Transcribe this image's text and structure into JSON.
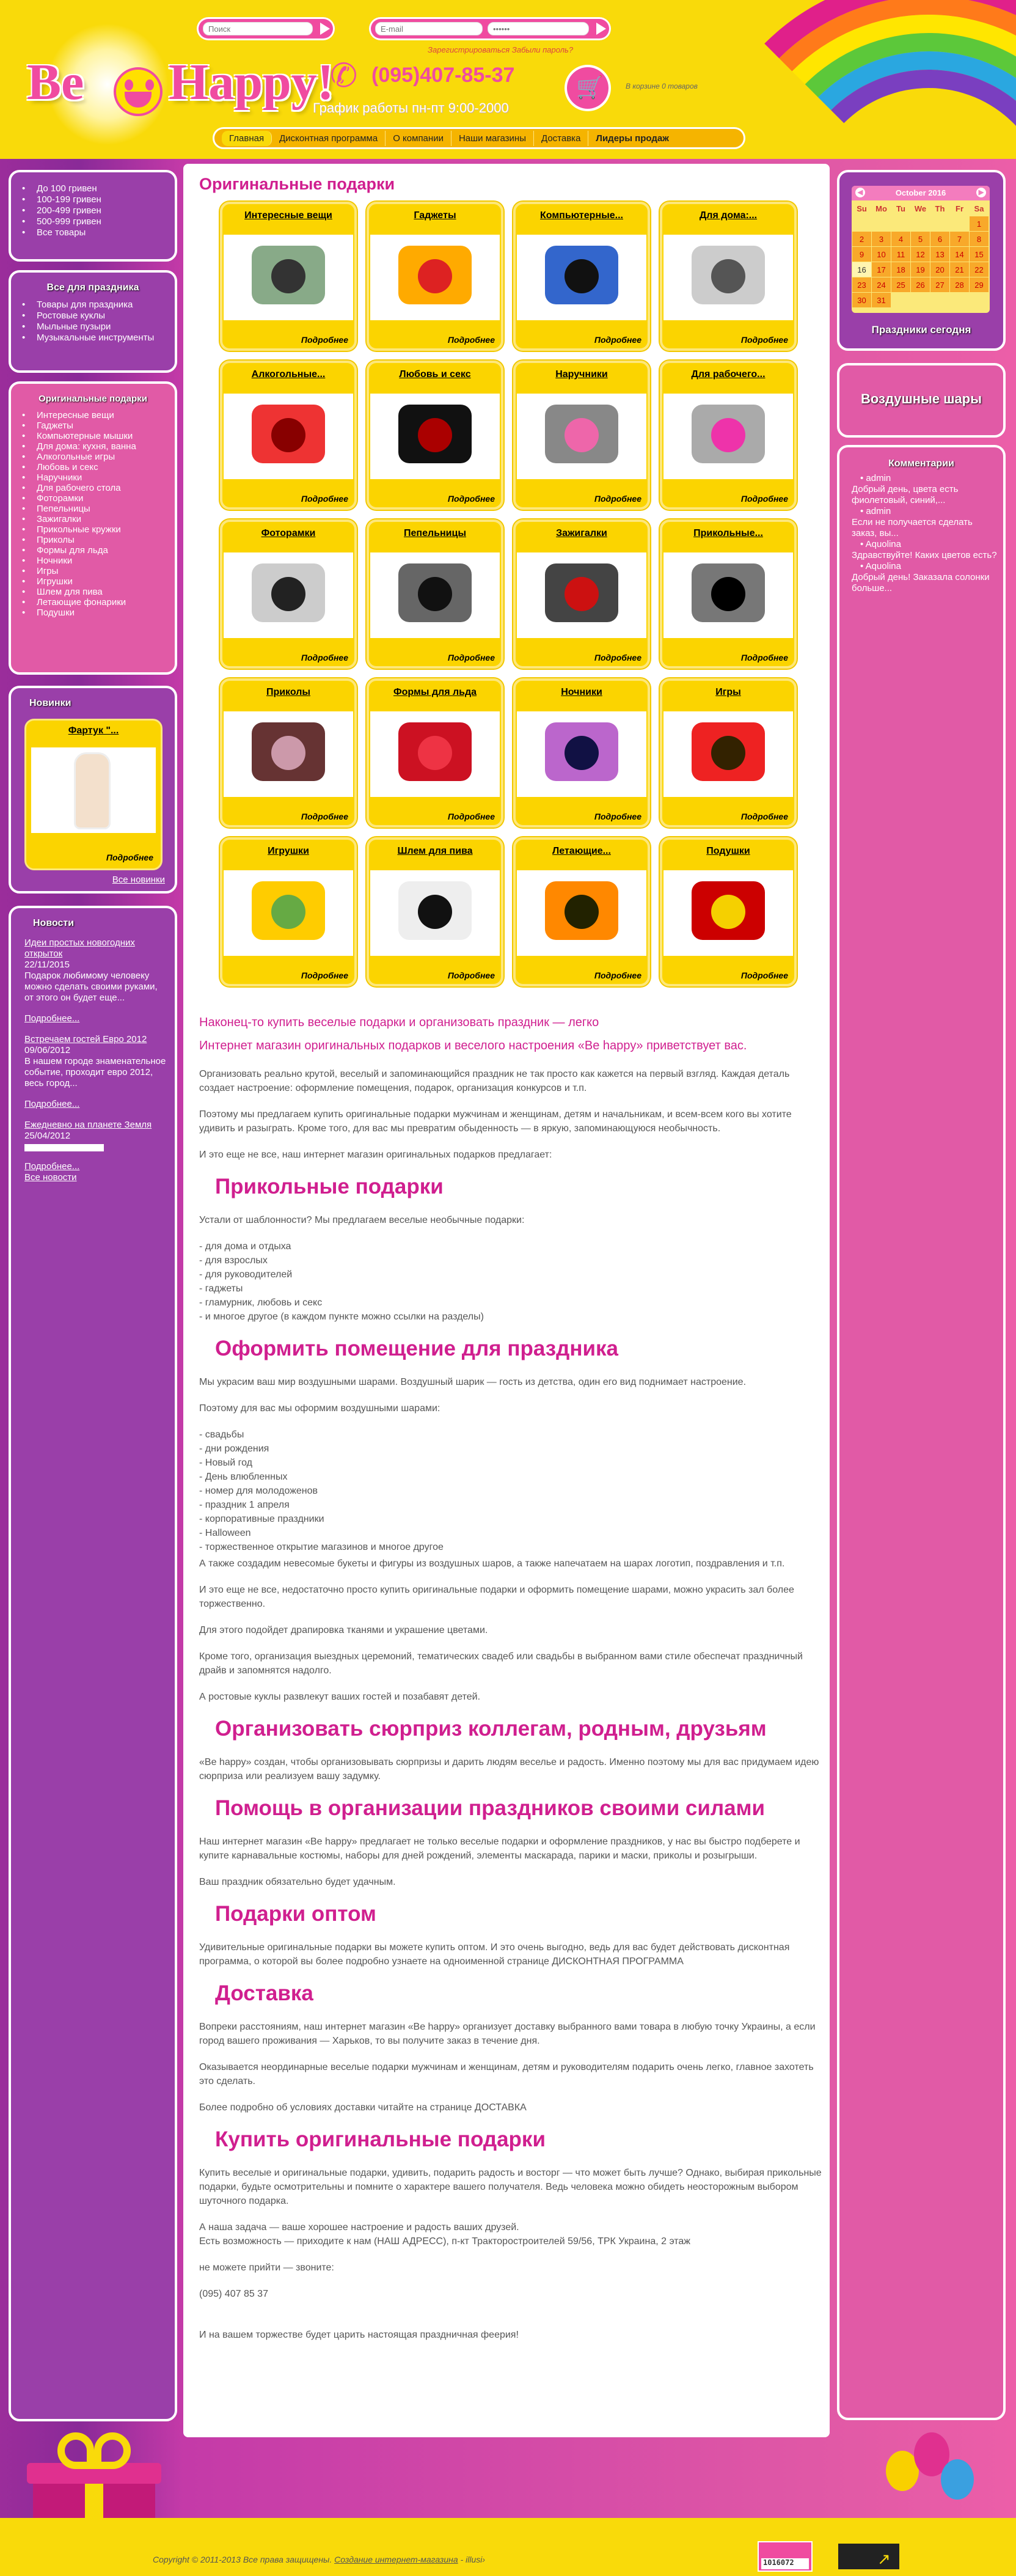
{
  "header": {
    "logo_text": "Be Happy!",
    "search_placeholder": "Поиск",
    "email_placeholder": "E-mail",
    "password_placeholder": "••••••",
    "register_link": "Зарегистрироваться",
    "forgot_link": "Забыли пароль?",
    "phone": "(095)407-85-37",
    "schedule": "График работы пн-пт 9:00-2000",
    "cart_text": "В корзине 0 товаров"
  },
  "menu": [
    "Главная",
    "Дисконтная программа",
    "О компании",
    "Наши магазины",
    "Доставка",
    "Лидеры продаж"
  ],
  "price_links": [
    "До 100 гривен",
    "100-199 гривен",
    "200-499 гривен",
    "500-999 гривен",
    "Все товары"
  ],
  "holiday": {
    "title": "Все для праздника",
    "items": [
      "Товары для праздника",
      "Ростовые куклы",
      "Мыльные пузыри",
      "Музыкальные инструменты"
    ]
  },
  "gifts": {
    "title": "Оригинальные подарки",
    "items": [
      "Интересные вещи",
      "Гаджеты",
      "Компьютерные мышки",
      "Для дома: кухня, ванна",
      "Алкогольные игры",
      "Любовь и секс",
      "Наручники",
      "Для рабочего стола",
      "Фоторамки",
      "Пепельницы",
      "Зажигалки",
      "Прикольные кружки",
      "Приколы",
      "Формы для льда",
      "Ночники",
      "Игры",
      "Игрушки",
      "Шлем для пива",
      "Летающие фонарики",
      "Подушки"
    ]
  },
  "novelties": {
    "title": "Новинки",
    "item": "Фартук \"...",
    "more": "Подробнее",
    "all": "Все новинки"
  },
  "news": {
    "title": "Новости",
    "items": [
      {
        "link": "Идеи простых новогодних открыток",
        "date": "22/11/2015",
        "text": "Подарок любимому человеку можно сделать своими руками, от этого он будет еще..."
      },
      {
        "link": "Встречаем гостей Евро 2012",
        "date": "09/06/2012",
        "text": "В нашем городе знаменательное событие, проходит евро 2012, весь город..."
      },
      {
        "link": "Ежедневно на планете Земля",
        "date": "25/04/2012",
        "text": ""
      }
    ],
    "more": "Подробнее...",
    "all": "Все новости"
  },
  "calendar": {
    "month": "October 2016",
    "days": [
      "Su",
      "Mo",
      "Tu",
      "We",
      "Th",
      "Fr",
      "Sa"
    ],
    "weeks": [
      [
        "",
        "",
        "",
        "",
        "",
        "",
        "1"
      ],
      [
        "2",
        "3",
        "4",
        "5",
        "6",
        "7",
        "8"
      ],
      [
        "9",
        "10",
        "11",
        "12",
        "13",
        "14",
        "15"
      ],
      [
        "16",
        "17",
        "18",
        "19",
        "20",
        "21",
        "22"
      ],
      [
        "23",
        "24",
        "25",
        "26",
        "27",
        "28",
        "29"
      ],
      [
        "30",
        "31",
        "",
        "",
        "",
        "",
        ""
      ]
    ],
    "today": "16",
    "footer": "Праздники сегодня"
  },
  "balloons_box": "Воздушные шары",
  "comments": {
    "title": "Комментарии",
    "items": [
      {
        "author": "admin",
        "text": "Добрый день, цвета есть фиолетовый, синий,..."
      },
      {
        "author": "admin",
        "text": "Если не получается сделать заказ, вы..."
      },
      {
        "author": "Aquolina",
        "text": "Здравствуйте! Каких цветов есть?"
      },
      {
        "author": "Aquolina",
        "text": "Добрый день! Заказала солонки больше..."
      }
    ]
  },
  "main": {
    "title": "Оригинальные подарки",
    "more": "Подробнее",
    "cards": [
      "Интересные вещи",
      "Гаджеты",
      "Компьютерные...",
      "Для дома:...",
      "Алкогольные...",
      "Любовь и секс",
      "Наручники",
      "Для рабочего...",
      "Фоторамки",
      "Пепельницы",
      "Зажигалки",
      "Прикольные...",
      "Приколы",
      "Формы для льда",
      "Ночники",
      "Игры",
      "Игрушки",
      "Шлем для пива",
      "Летающие...",
      "Подушки"
    ]
  },
  "article": {
    "lead1": "Наконец-то купить веселые подарки и организовать праздник — легко",
    "lead2": "Интернет магазин оригинальных подарков и веселого настроения «Be happy» приветствует вас.",
    "p1": "Организовать реально крутой, веселый и запоминающийся праздник не так просто как кажется на первый взгляд. Каждая деталь создает настроение: оформление помещения, подарок, организация конкурсов и т.п.",
    "p2": "Поэтому мы предлагаем купить оригинальные подарки мужчинам и женщинам, детям и начальникам, и всем-всем кого вы хотите удивить и разыграть. Кроме того, для вас мы превратим обыденность — в яркую, запоминающуюся необычность.",
    "p3": "И это еще не все, наш интернет магазин оригинальных подарков предлагает:",
    "h1": "Прикольные подарки",
    "p4": "Устали от шаблонности? Мы предлагаем веселые необычные подарки:",
    "list1": [
      "- для дома и отдыха",
      "- для взрослых",
      "- для руководителей",
      "- гаджеты",
      "- гламурник, любовь и секс",
      "- и многое другое (в каждом пункте можно ссылки на разделы)"
    ],
    "h2": "Оформить помещение для праздника",
    "p5": "Мы украсим ваш мир воздушными шарами. Воздушный шарик — гость из детства, один его вид поднимает настроение.",
    "p6": "Поэтому для вас мы оформим воздушными шарами:",
    "list2": [
      "- свадьбы",
      "- дни рождения",
      "- Новый год",
      "- День влюбленных",
      "- номер для молодоженов",
      "- праздник 1 апреля",
      "- корпоративные праздники",
      "- Halloween",
      "- торжественное открытие магазинов и многое другое"
    ],
    "p7": "А также создадим невесомые букеты и фигуры из воздушных шаров, а также напечатаем на шарах логотип, поздравления и т.п.",
    "p8": "И это еще не все, недостаточно просто купить оригинальные подарки и оформить помещение шарами, можно украсить зал более торжественно.",
    "p9": "Для этого подойдет драпировка тканями и украшение цветами.",
    "p10": "Кроме того, организация выездных церемоний, тематических свадеб или свадьбы в выбранном вами стиле обеспечат праздничный драйв и запомнятся надолго.",
    "p11": "А ростовые куклы развлекут ваших гостей и позабавят детей.",
    "h3": "Организовать сюрприз коллегам, родным, друзьям",
    "p12": "«Be happy» создан, чтобы организовывать сюрпризы и дарить людям веселье и радость. Именно поэтому мы для вас придумаем идею сюрприза или реализуем вашу задумку.",
    "h4": "Помощь в организации праздников своими силами",
    "p13": "Наш интернет магазин «Be happy» предлагает не только веселые подарки и оформление праздников, у нас вы быстро подберете и купите карнавальные костюмы, наборы для дней рождений, элементы маскарада, парики и маски, приколы и розыгрыши.",
    "p14": "Ваш праздник обязательно будет удачным.",
    "h5": "Подарки оптом",
    "p15": "Удивительные оригинальные подарки вы можете купить оптом. И это очень выгодно, ведь для вас будет действовать дисконтная программа, о которой вы более подробно узнаете на одноименной странице ДИСКОНТНАЯ ПРОГРАММА",
    "h6": "Доставка",
    "p16": "Вопреки расстояниям, наш интернет магазин «Be happy» организует доставку выбранного вами товара в любую точку Украины, а если город вашего проживания — Харьков, то вы получите заказ в течение дня.",
    "p17": "Оказывается неординарные веселые подарки мужчинам и женщинам, детям и руководителям подарить очень легко, главное захотеть это сделать.",
    "p18": "Более подробно об условиях доставки читайте на странице ДОСТАВКА",
    "h7": "Купить оригинальные подарки",
    "p19": "Купить веселые и оригинальные подарки, удивить, подарить радость и восторг — что может быть лучше? Однако, выбирая прикольные подарки, будьте осмотрительны и помните о характере вашего получателя. Ведь человека можно обидеть неосторожным выбором шуточного подарка.",
    "p20a": "А наша задача — ваше хорошее настроение и радость ваших друзей.",
    "p20b": "Есть возможность — приходите к нам (НАШ АДРЕСС), п-кт Тракторостроителей 59/56, ТРК Украина, 2 этаж",
    "p21": "не можете прийти — звоните:",
    "p22": "(095) 407 85 37",
    "p23": "И на вашем торжестве будет царить настоящая праздничная феерия!"
  },
  "footer": {
    "copyright": "Copyright © 2011-2013 Все права защищены.",
    "dev_link": "Создание интернет-магазина",
    "dev_name": "- illusi›",
    "counter": "1016072"
  },
  "colors": {
    "yellow": "#f9da0a",
    "pink": "#d01f8f",
    "purple": "#9a3fa9"
  }
}
